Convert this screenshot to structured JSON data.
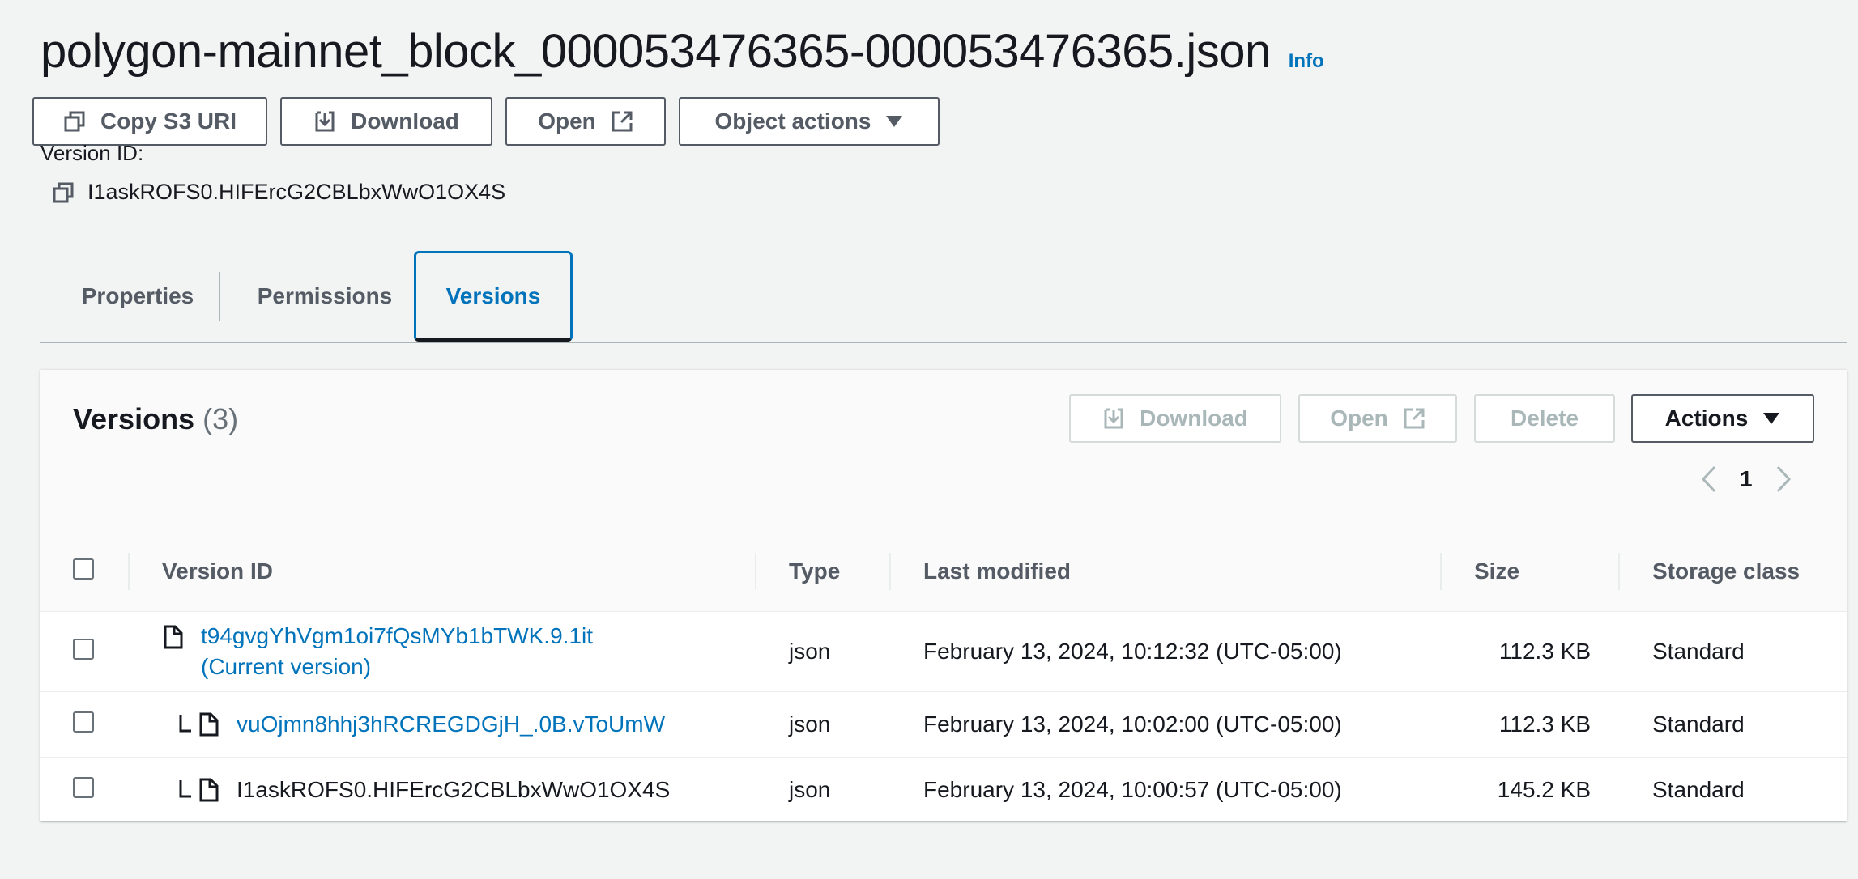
{
  "header": {
    "title": "polygon-mainnet_block_000053476365-000053476365.json",
    "info_label": "Info"
  },
  "actions": {
    "copy_s3_uri": "Copy S3 URI",
    "download": "Download",
    "open": "Open",
    "object_actions": "Object actions"
  },
  "version": {
    "label": "Version ID:",
    "value": "I1askROFS0.HIFErcG2CBLbxWwO1OX4S"
  },
  "tabs": [
    {
      "label": "Properties"
    },
    {
      "label": "Permissions"
    },
    {
      "label": "Versions",
      "selected": true
    }
  ],
  "versions_panel": {
    "title": "Versions",
    "count": "(3)",
    "download": "Download",
    "open": "Open",
    "delete": "Delete",
    "actions": "Actions",
    "page": "1",
    "columns": [
      "Version ID",
      "Type",
      "Last modified",
      "Size",
      "Storage class"
    ],
    "rows": [
      {
        "version_id": "t94gvgYhVgm1oi7fQsMYb1bTWK.9.1it",
        "note": "(Current version)",
        "type": "json",
        "last_modified": "February 13, 2024, 10:12:32 (UTC-05:00)",
        "size": "112.3 KB",
        "storage_class": "Standard"
      },
      {
        "version_id": "vuOjmn8hhj3hRCREGDGjH_.0B.vToUmW",
        "type": "json",
        "last_modified": "February 13, 2024, 10:02:00 (UTC-05:00)",
        "size": "112.3 KB",
        "storage_class": "Standard"
      },
      {
        "version_id": "I1askROFS0.HIFErcG2CBLbxWwO1OX4S",
        "type": "json",
        "last_modified": "February 13, 2024, 10:00:57 (UTC-05:00)",
        "size": "145.2 KB",
        "storage_class": "Standard"
      }
    ]
  },
  "colors": {
    "link": "#0073bb",
    "text": "#16191f",
    "muted": "#545b64",
    "disabled": "#aab7b8",
    "background": "#f2f3f3"
  }
}
